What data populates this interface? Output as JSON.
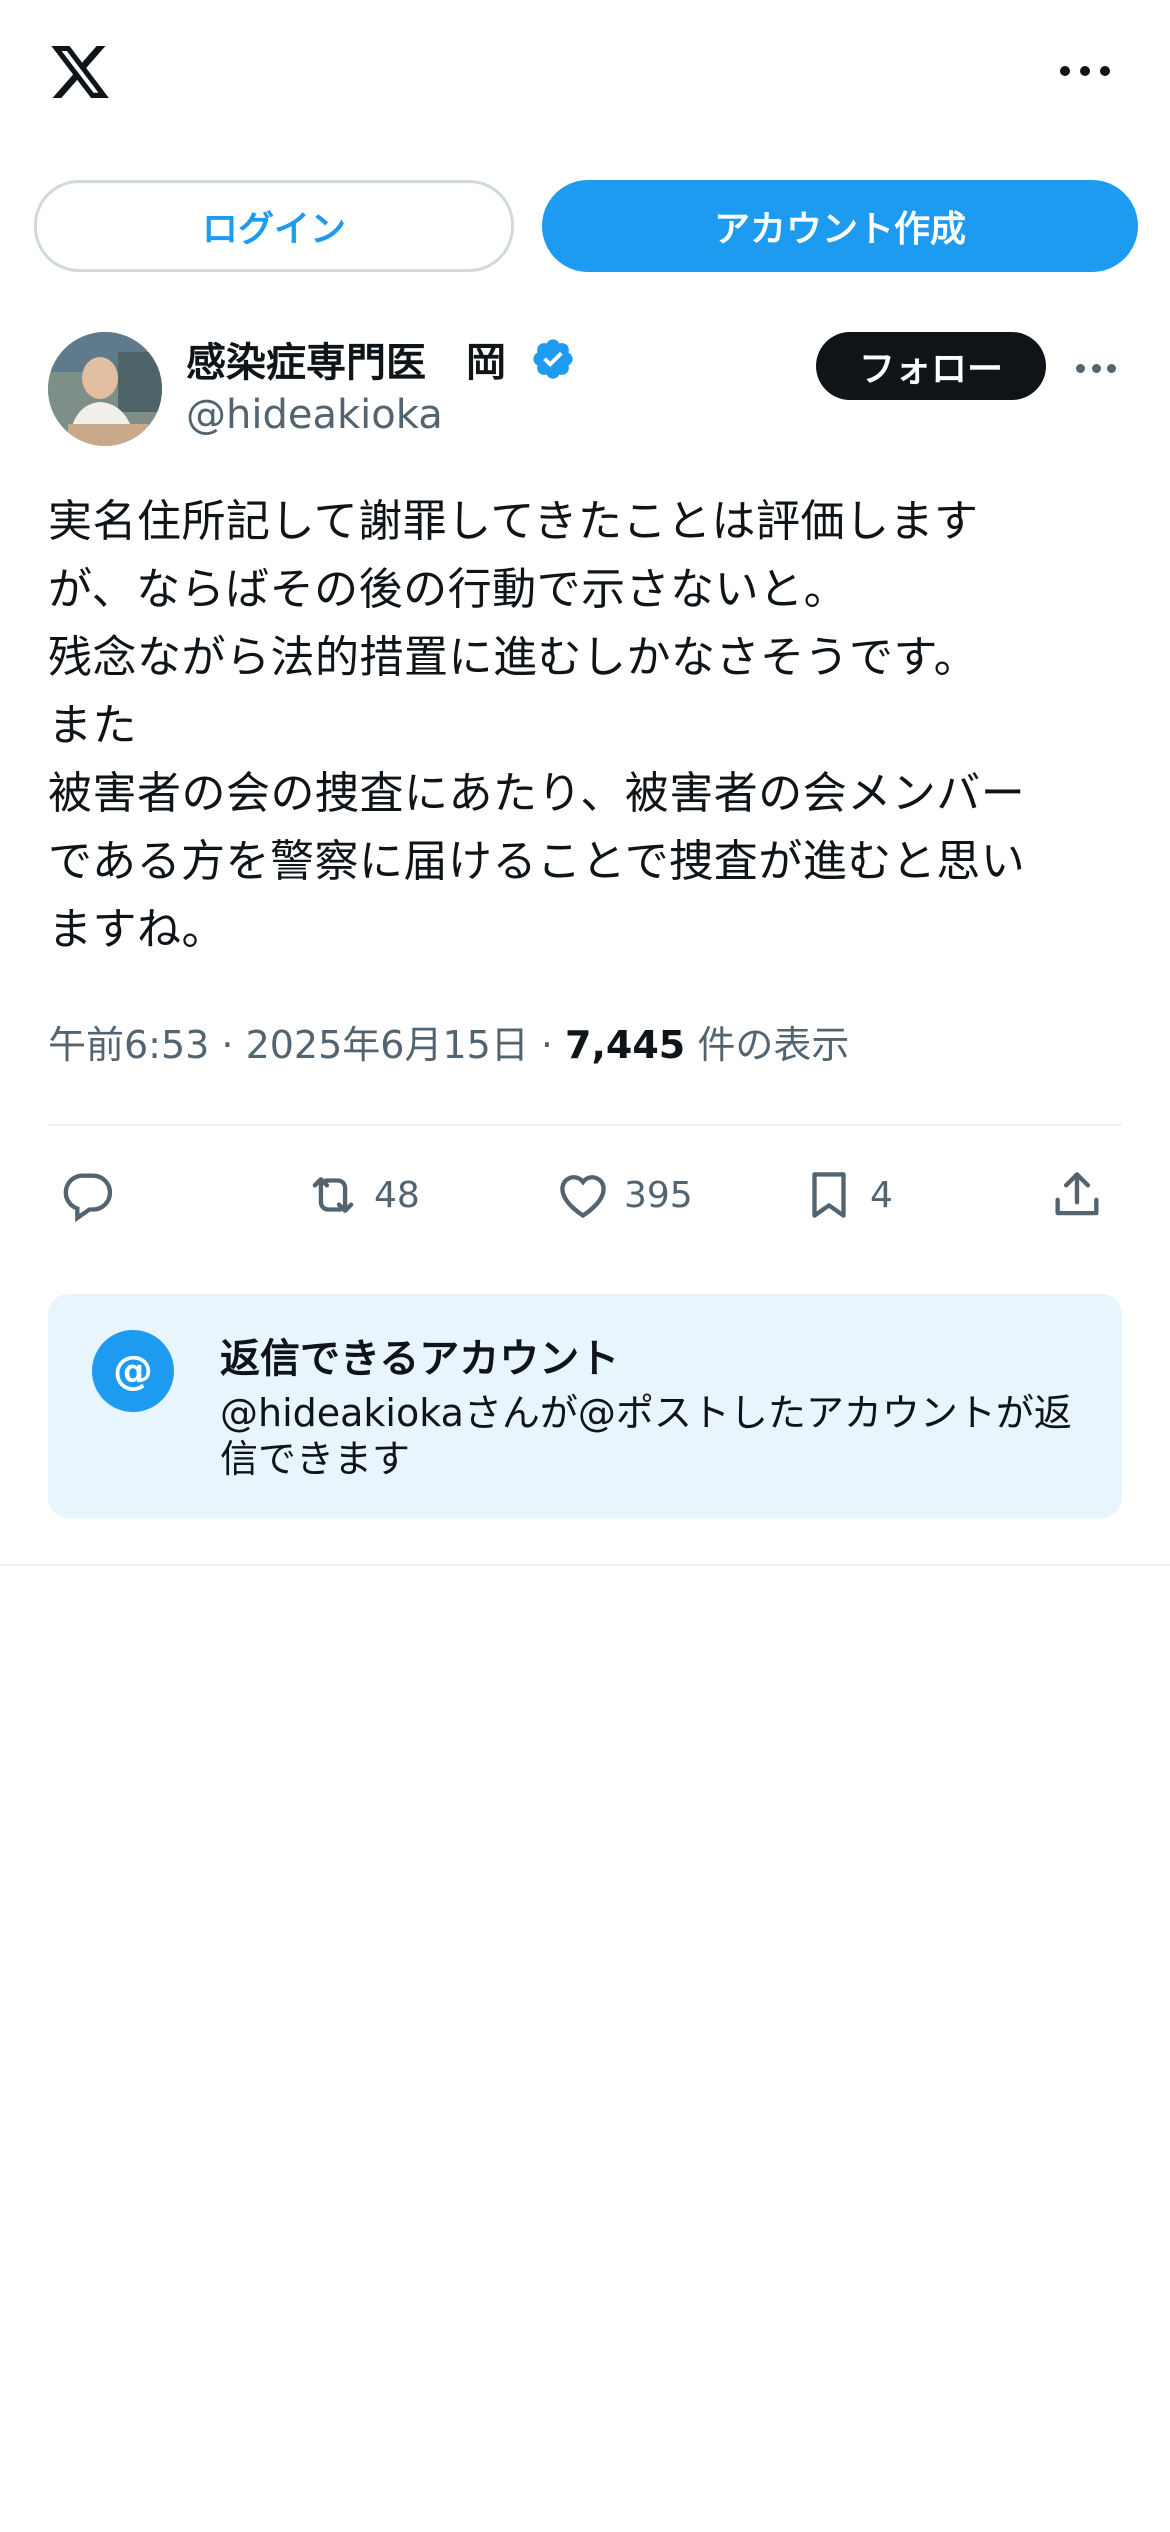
{
  "header": {
    "logo": "x-logo",
    "more_icon": "more-horizontal-icon"
  },
  "auth": {
    "login_label": "ログイン",
    "signup_label": "アカウント作成"
  },
  "post": {
    "author_name": "感染症専門医　岡",
    "author_handle": "@hideakioka",
    "verified": true,
    "follow_label": "フォロー",
    "text": "実名住所記して謝罪してきたことは評価します\nが、ならばその後の行動で示さないと。\n残念ながら法的措置に進むしかなさそうです。\nまた\n被害者の会の捜査にあたり、被害者の会メンバー\nである方を警察に届けることで捜査が進むと思い\nますね。",
    "time": "午前6:53 · 2025年6月15日 · ",
    "views_count": "7,445",
    "views_label": " 件の表示",
    "actions": {
      "reply_count": "",
      "retweet_count": "48",
      "like_count": "395",
      "bookmark_count": "4"
    }
  },
  "reply_restriction": {
    "icon": "@",
    "title": "返信できるアカウント",
    "description": "@hideakiokaさんが@ポストしたアカウントが返信できます"
  },
  "colors": {
    "accent": "#1d9bf0",
    "text": "#0f1419",
    "muted": "#536471",
    "reply_bg": "#e8f5fd"
  }
}
